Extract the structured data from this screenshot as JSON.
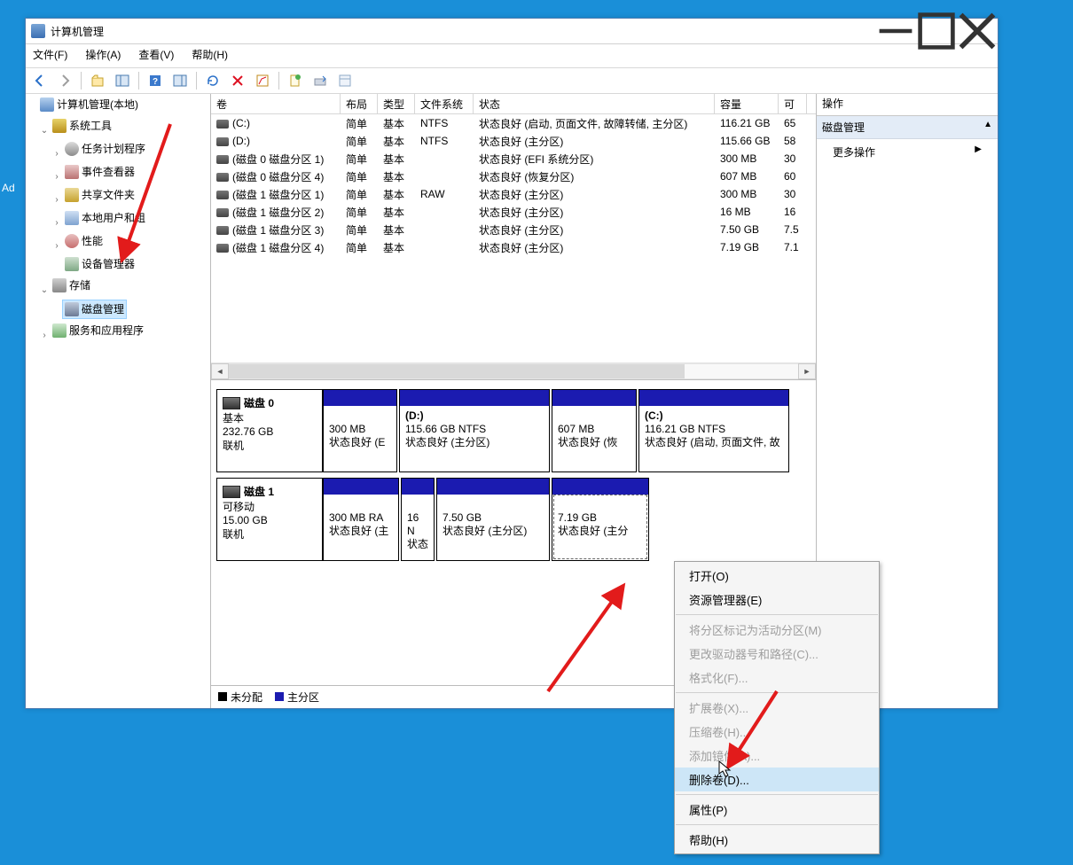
{
  "desktop_label_partial": "Ad",
  "window": {
    "title": "计算机管理",
    "controls": {
      "min": "minimize",
      "max": "maximize",
      "close": "close"
    }
  },
  "menubar": [
    "文件(F)",
    "操作(A)",
    "查看(V)",
    "帮助(H)"
  ],
  "tree": {
    "root": "计算机管理(本地)",
    "system_tools": "系统工具",
    "task_scheduler": "任务计划程序",
    "event_viewer": "事件查看器",
    "shared_folders": "共享文件夹",
    "local_users_groups": "本地用户和组",
    "performance": "性能",
    "device_manager": "设备管理器",
    "storage": "存储",
    "disk_management": "磁盘管理",
    "services_apps": "服务和应用程序"
  },
  "columns": {
    "volume": "卷",
    "layout": "布局",
    "type": "类型",
    "fs": "文件系统",
    "status": "状态",
    "capacity": "容量",
    "free": "可"
  },
  "volumes": [
    {
      "vol": "(C:)",
      "layout": "简单",
      "type": "基本",
      "fs": "NTFS",
      "status": "状态良好 (启动, 页面文件, 故障转储, 主分区)",
      "cap": "116.21 GB",
      "free": "65"
    },
    {
      "vol": "(D:)",
      "layout": "简单",
      "type": "基本",
      "fs": "NTFS",
      "status": "状态良好 (主分区)",
      "cap": "115.66 GB",
      "free": "58"
    },
    {
      "vol": "(磁盘 0 磁盘分区 1)",
      "layout": "简单",
      "type": "基本",
      "fs": "",
      "status": "状态良好 (EFI 系统分区)",
      "cap": "300 MB",
      "free": "30"
    },
    {
      "vol": "(磁盘 0 磁盘分区 4)",
      "layout": "简单",
      "type": "基本",
      "fs": "",
      "status": "状态良好 (恢复分区)",
      "cap": "607 MB",
      "free": "60"
    },
    {
      "vol": "(磁盘 1 磁盘分区 1)",
      "layout": "简单",
      "type": "基本",
      "fs": "RAW",
      "status": "状态良好 (主分区)",
      "cap": "300 MB",
      "free": "30"
    },
    {
      "vol": "(磁盘 1 磁盘分区 2)",
      "layout": "简单",
      "type": "基本",
      "fs": "",
      "status": "状态良好 (主分区)",
      "cap": "16 MB",
      "free": "16"
    },
    {
      "vol": "(磁盘 1 磁盘分区 3)",
      "layout": "简单",
      "type": "基本",
      "fs": "",
      "status": "状态良好 (主分区)",
      "cap": "7.50 GB",
      "free": "7.5"
    },
    {
      "vol": "(磁盘 1 磁盘分区 4)",
      "layout": "简单",
      "type": "基本",
      "fs": "",
      "status": "状态良好 (主分区)",
      "cap": "7.19 GB",
      "free": "7.1"
    }
  ],
  "disks": {
    "d0": {
      "name": "磁盘 0",
      "kind": "基本",
      "size": "232.76 GB",
      "state": "联机",
      "parts": [
        {
          "label": "",
          "l2": "300 MB",
          "l3": "状态良好 (E",
          "w": 82
        },
        {
          "label": "(D:)",
          "l2": "115.66 GB NTFS",
          "l3": "状态良好 (主分区)",
          "w": 168
        },
        {
          "label": "",
          "l2": "607 MB",
          "l3": "状态良好 (恢",
          "w": 94
        },
        {
          "label": "(C:)",
          "l2": "116.21 GB NTFS",
          "l3": "状态良好 (启动, 页面文件, 故",
          "w": 168
        }
      ]
    },
    "d1": {
      "name": "磁盘 1",
      "kind": "可移动",
      "size": "15.00 GB",
      "state": "联机",
      "parts": [
        {
          "label": "",
          "l2": "300 MB RA",
          "l3": "状态良好 (主",
          "w": 84
        },
        {
          "label": "",
          "l2": "16 N",
          "l3": "状态",
          "w": 36
        },
        {
          "label": "",
          "l2": "7.50 GB",
          "l3": "状态良好 (主分区)",
          "w": 126
        },
        {
          "label": "",
          "l2": "7.19 GB",
          "l3": "状态良好 (主分",
          "w": 108,
          "selected": true
        }
      ]
    }
  },
  "legend": {
    "unalloc": "未分配",
    "primary": "主分区"
  },
  "actions": {
    "header": "操作",
    "title": "磁盘管理",
    "more": "更多操作"
  },
  "context_menu": [
    {
      "label": "打开(O)",
      "enabled": true
    },
    {
      "label": "资源管理器(E)",
      "enabled": true
    },
    {
      "sep": true
    },
    {
      "label": "将分区标记为活动分区(M)",
      "enabled": false
    },
    {
      "label": "更改驱动器号和路径(C)...",
      "enabled": false
    },
    {
      "label": "格式化(F)...",
      "enabled": false
    },
    {
      "sep": true
    },
    {
      "label": "扩展卷(X)...",
      "enabled": false
    },
    {
      "label": "压缩卷(H)...",
      "enabled": false
    },
    {
      "label": "添加镜像(A)...",
      "enabled": false
    },
    {
      "label": "删除卷(D)...",
      "enabled": true,
      "highlight": true
    },
    {
      "sep": true
    },
    {
      "label": "属性(P)",
      "enabled": true
    },
    {
      "sep": true
    },
    {
      "label": "帮助(H)",
      "enabled": true
    }
  ]
}
